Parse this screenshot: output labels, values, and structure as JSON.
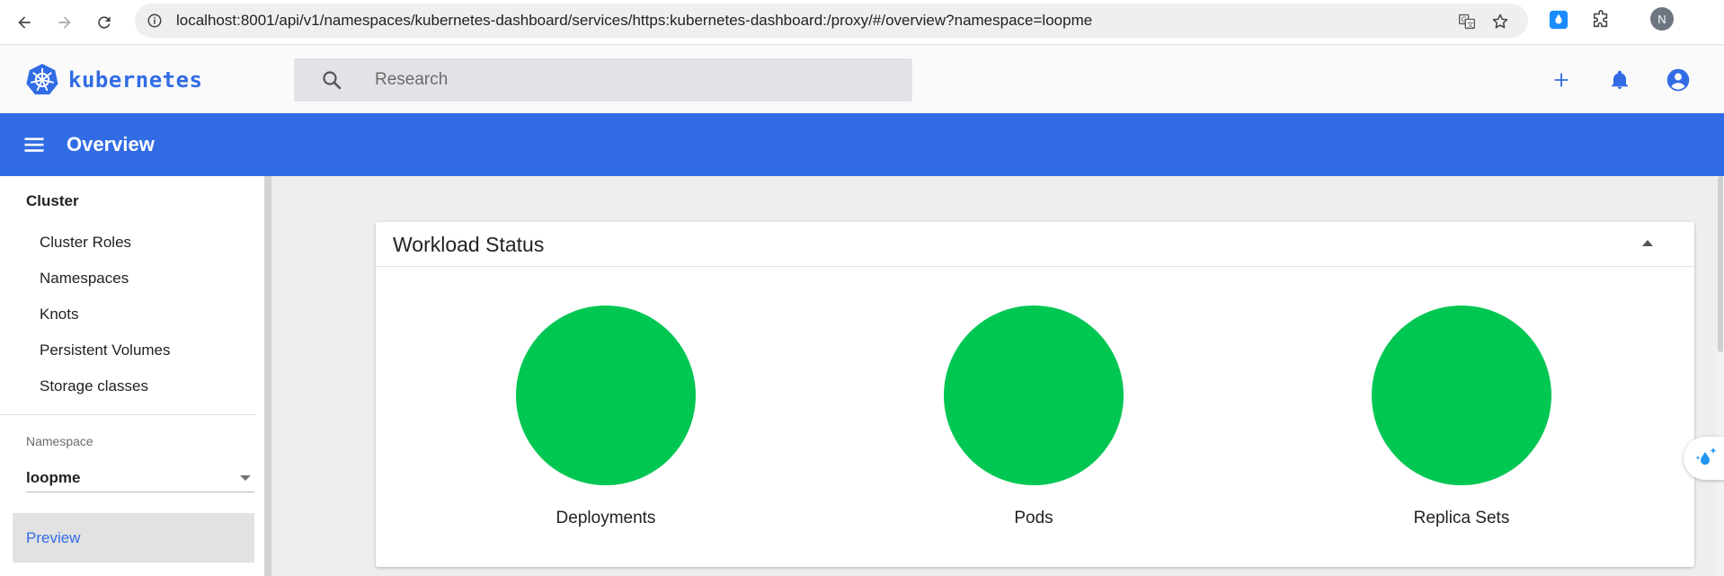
{
  "browser": {
    "url": "localhost:8001/api/v1/namespaces/kubernetes-dashboard/services/https:kubernetes-dashboard:/proxy/#/overview?namespace=loopme",
    "profile_initial": "N"
  },
  "header": {
    "logo_text": "kubernetes",
    "search_placeholder": "Research"
  },
  "toolbar": {
    "title": "Overview"
  },
  "sidebar": {
    "section": "Cluster",
    "items": [
      {
        "label": "Cluster Roles"
      },
      {
        "label": "Namespaces"
      },
      {
        "label": "Knots"
      },
      {
        "label": "Persistent Volumes"
      },
      {
        "label": "Storage classes"
      }
    ],
    "namespace_label": "Namespace",
    "namespace_value": "loopme",
    "preview_label": "Preview"
  },
  "workload_status": {
    "title": "Workload Status",
    "items": [
      {
        "label": "Deployments",
        "color": "#00c752"
      },
      {
        "label": "Pods",
        "color": "#00c752"
      },
      {
        "label": "Replica Sets",
        "color": "#00c752"
      }
    ]
  },
  "colors": {
    "brand": "#326ce5",
    "success": "#00c752"
  }
}
